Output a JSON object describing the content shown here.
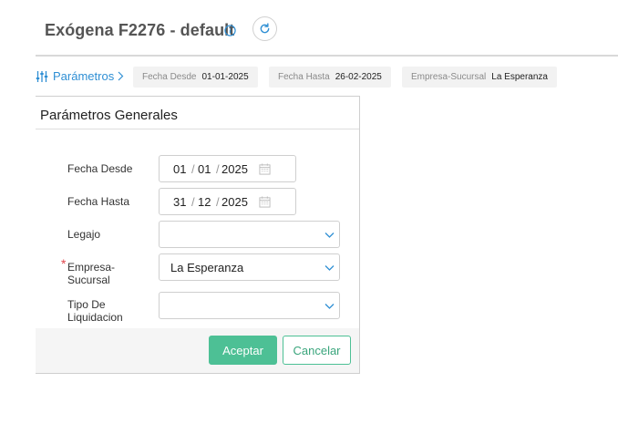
{
  "header": {
    "title": "Exógena F2276 - default"
  },
  "params_bar": {
    "link_label": "Parámetros",
    "chips": [
      {
        "key": "Fecha Desde",
        "value": "01-01-2025"
      },
      {
        "key": "Fecha Hasta",
        "value": "26-02-2025"
      },
      {
        "key": "Empresa-Sucursal",
        "value": "La Esperanza"
      }
    ]
  },
  "panel": {
    "title": "Parámetros Generales",
    "fecha_desde": {
      "label": "Fecha Desde",
      "day": "01",
      "month": "01",
      "year": "2025"
    },
    "fecha_hasta": {
      "label": "Fecha Hasta",
      "day": "31",
      "month": "12",
      "year": "2025"
    },
    "legajo": {
      "label": "Legajo",
      "value": ""
    },
    "empresa_sucursal": {
      "label_line1": "Empresa-",
      "label_line2": "Sucursal",
      "value": "La Esperanza",
      "required_mark": "*"
    },
    "tipo_liquidacion": {
      "label_line1": "Tipo De",
      "label_line2": "Liquidacion",
      "value": ""
    },
    "date_separator": "/",
    "accept_label": "Aceptar",
    "cancel_label": "Cancelar"
  },
  "colors": {
    "accent_blue": "#2f8fd4",
    "accent_green": "#4dc095",
    "required_red": "#e0454b"
  }
}
